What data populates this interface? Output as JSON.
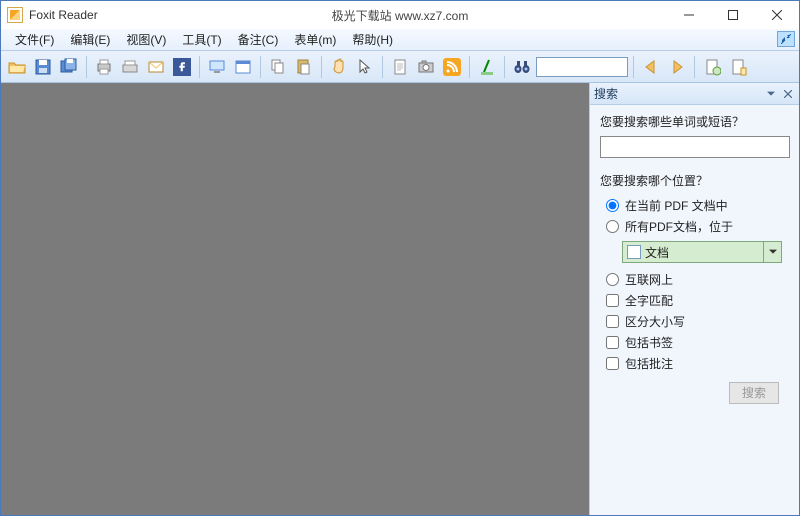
{
  "title": {
    "app": "Foxit Reader",
    "center": "极光下载站 www.xz7.com"
  },
  "menu": {
    "file": "文件(F)",
    "edit": "编辑(E)",
    "view": "视图(V)",
    "tools": "工具(T)",
    "note": "备注(C)",
    "form": "表单(m)",
    "help": "帮助(H)"
  },
  "search_panel": {
    "title": "搜索",
    "q_label": "您要搜索哪些单词或短语？",
    "loc_label": "您要搜索哪个位置？",
    "opt_current": "在当前 PDF 文档中",
    "opt_all": "所有PDF文档，位于",
    "combo_value": "文档",
    "opt_internet": "互联网上",
    "opt_whole": "全字匹配",
    "opt_case": "区分大小写",
    "opt_bookmark": "包括书签",
    "opt_annot": "包括批注",
    "button": "搜索"
  }
}
